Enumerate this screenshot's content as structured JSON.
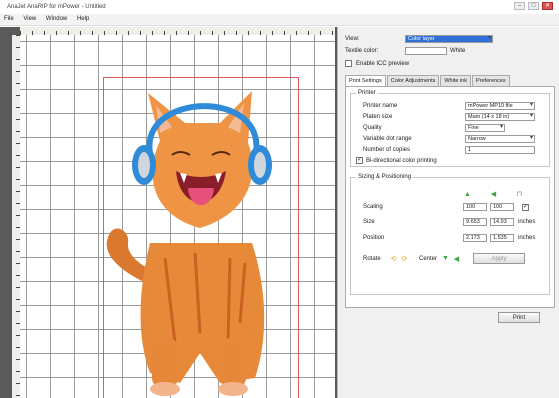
{
  "window": {
    "title": "AnaJet AnaRIP for mPower - Untitled",
    "minimize": "–",
    "maximize": "□",
    "close": "✕"
  },
  "menu": [
    "File",
    "View",
    "Window",
    "Help"
  ],
  "panel": {
    "view_label": "View:",
    "view_value": "Color layer",
    "textile_label": "Textile color:",
    "textile_value": "",
    "textile_suffix": "White",
    "icc_label": "Enable ICC preview",
    "tabs": [
      "Print Settings",
      "Color Adjustments",
      "White ink",
      "Preferences"
    ],
    "printer_group": {
      "title": "Printer",
      "printer_name_label": "Printer name",
      "printer_name_value": "mPower MP10 file",
      "platen_label": "Platen size",
      "platen_value": "Mam (14 x 18 in)",
      "quality_label": "Quality",
      "quality_value": "Fine",
      "dot_label": "Variable dot range",
      "dot_value": "Narrow",
      "copies_label": "Number of copies",
      "copies_value": "1",
      "bidir_label": "Bi-directional color printing"
    },
    "sizing_group": {
      "title": "Sizing & Positioning",
      "scaling_label": "Scaling",
      "scaling_x": "100",
      "scaling_y": "100",
      "size_label": "Size",
      "size_w": "9.653",
      "size_h": "14.93",
      "size_unit": "inches",
      "position_label": "Position",
      "pos_x": "2.173",
      "pos_y": "1.535",
      "pos_unit": "inches",
      "rotate_label": "Rotate",
      "center_label": "Center",
      "apply_label": "Apply"
    },
    "print_label": "Print"
  }
}
